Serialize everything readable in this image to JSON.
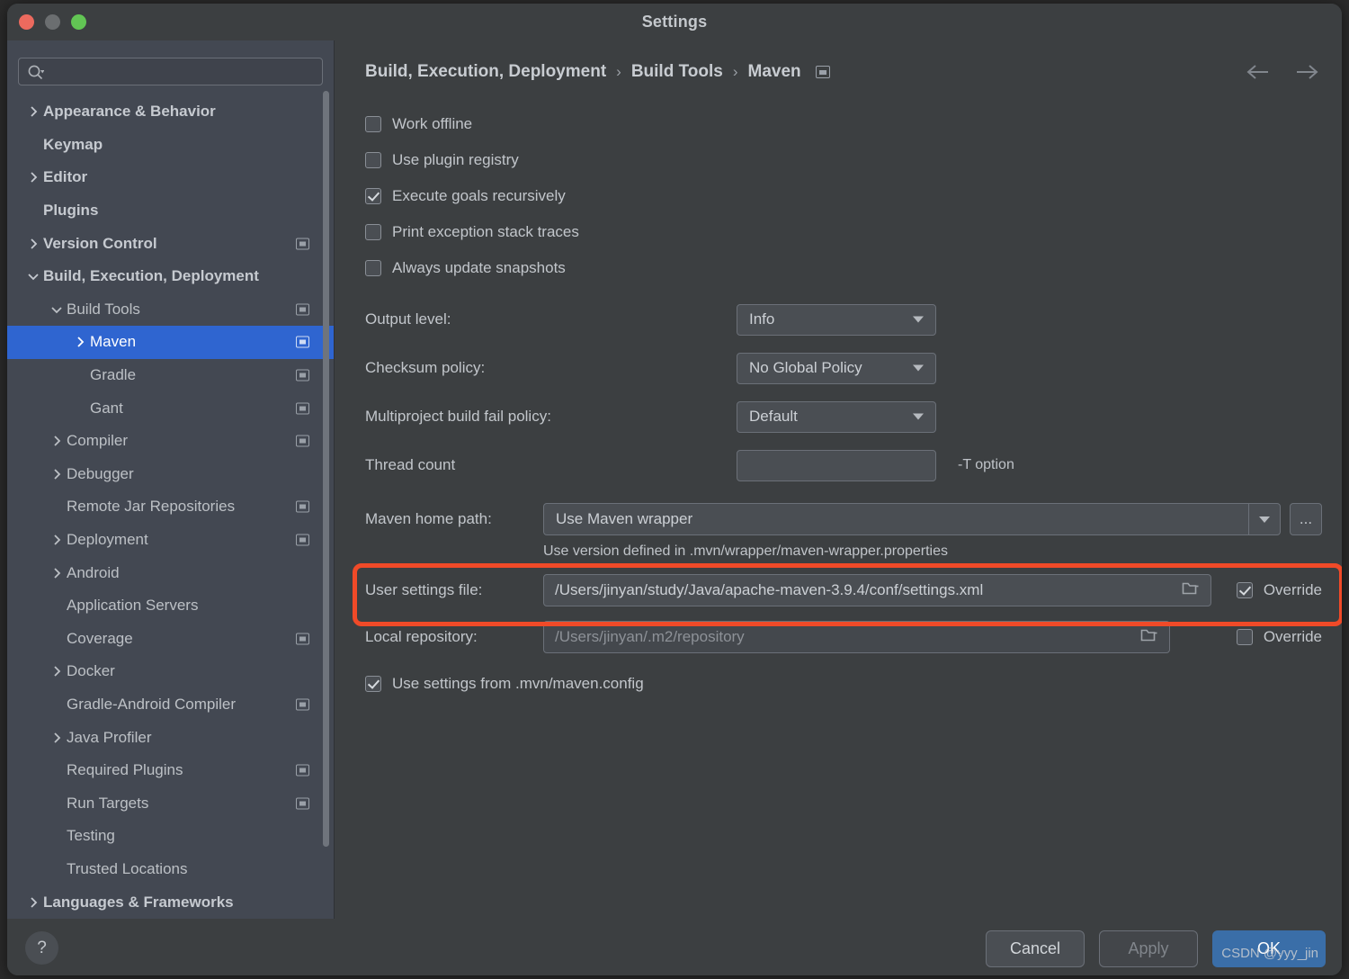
{
  "window": {
    "title": "Settings",
    "traffic_lights": [
      "close-red",
      "minimize-yellow",
      "zoom-green"
    ]
  },
  "search": {
    "value": "",
    "placeholder": "",
    "icon": "search-icon"
  },
  "sidebar": {
    "items": [
      {
        "label": "Appearance & Behavior",
        "indent": 0,
        "chevron": "right",
        "bold": true,
        "badge": false
      },
      {
        "label": "Keymap",
        "indent": 0,
        "chevron": "none",
        "bold": true,
        "badge": false
      },
      {
        "label": "Editor",
        "indent": 0,
        "chevron": "right",
        "bold": true,
        "badge": false
      },
      {
        "label": "Plugins",
        "indent": 0,
        "chevron": "none",
        "bold": true,
        "badge": false
      },
      {
        "label": "Version Control",
        "indent": 0,
        "chevron": "right",
        "bold": true,
        "badge": true
      },
      {
        "label": "Build, Execution, Deployment",
        "indent": 0,
        "chevron": "down",
        "bold": true,
        "badge": false
      },
      {
        "label": "Build Tools",
        "indent": 1,
        "chevron": "down",
        "bold": false,
        "badge": true
      },
      {
        "label": "Maven",
        "indent": 2,
        "chevron": "right",
        "bold": false,
        "badge": true,
        "selected": true
      },
      {
        "label": "Gradle",
        "indent": 2,
        "chevron": "none",
        "bold": false,
        "badge": true
      },
      {
        "label": "Gant",
        "indent": 2,
        "chevron": "none",
        "bold": false,
        "badge": true
      },
      {
        "label": "Compiler",
        "indent": 1,
        "chevron": "right",
        "bold": false,
        "badge": true
      },
      {
        "label": "Debugger",
        "indent": 1,
        "chevron": "right",
        "bold": false,
        "badge": false
      },
      {
        "label": "Remote Jar Repositories",
        "indent": 1,
        "chevron": "none",
        "bold": false,
        "badge": true
      },
      {
        "label": "Deployment",
        "indent": 1,
        "chevron": "right",
        "bold": false,
        "badge": true
      },
      {
        "label": "Android",
        "indent": 1,
        "chevron": "right",
        "bold": false,
        "badge": false
      },
      {
        "label": "Application Servers",
        "indent": 1,
        "chevron": "none",
        "bold": false,
        "badge": false
      },
      {
        "label": "Coverage",
        "indent": 1,
        "chevron": "none",
        "bold": false,
        "badge": true
      },
      {
        "label": "Docker",
        "indent": 1,
        "chevron": "right",
        "bold": false,
        "badge": false
      },
      {
        "label": "Gradle-Android Compiler",
        "indent": 1,
        "chevron": "none",
        "bold": false,
        "badge": true
      },
      {
        "label": "Java Profiler",
        "indent": 1,
        "chevron": "right",
        "bold": false,
        "badge": false
      },
      {
        "label": "Required Plugins",
        "indent": 1,
        "chevron": "none",
        "bold": false,
        "badge": true
      },
      {
        "label": "Run Targets",
        "indent": 1,
        "chevron": "none",
        "bold": false,
        "badge": true
      },
      {
        "label": "Testing",
        "indent": 1,
        "chevron": "none",
        "bold": false,
        "badge": false
      },
      {
        "label": "Trusted Locations",
        "indent": 1,
        "chevron": "none",
        "bold": false,
        "badge": false
      },
      {
        "label": "Languages & Frameworks",
        "indent": 0,
        "chevron": "right",
        "bold": true,
        "badge": false
      }
    ]
  },
  "breadcrumb": {
    "part1": "Build, Execution, Deployment",
    "sep1": "›",
    "part2": "Build Tools",
    "sep2": "›",
    "part3": "Maven",
    "badge_icon": "project-scope-badge-icon",
    "back_icon": "arrow-left-icon",
    "forward_icon": "arrow-right-icon"
  },
  "main": {
    "checkboxes": [
      {
        "label": "Work offline",
        "checked": false
      },
      {
        "label": "Use plugin registry",
        "checked": false
      },
      {
        "label": "Execute goals recursively",
        "checked": true
      },
      {
        "label": "Print exception stack traces",
        "checked": false
      },
      {
        "label": "Always update snapshots",
        "checked": false
      }
    ],
    "fields": [
      {
        "label": "Output level:",
        "value": "Info",
        "type": "combo"
      },
      {
        "label": "Checksum policy:",
        "value": "No Global Policy",
        "type": "combo"
      },
      {
        "label": "Multiproject build fail policy:",
        "value": "Default",
        "type": "combo"
      },
      {
        "label": "Thread count",
        "value": "",
        "type": "text",
        "note": "-T option"
      }
    ],
    "maven_home": {
      "label": "Maven home path:",
      "value": "Use Maven wrapper",
      "browse_label": "...",
      "hint": "Use version defined in .mvn/wrapper/maven-wrapper.properties"
    },
    "user_settings": {
      "label": "User settings file:",
      "value": "/Users/jinyan/study/Java/apache-maven-3.9.4/conf/settings.xml",
      "override_label": "Override",
      "override_checked": true,
      "folder_icon": "folder-icon",
      "highlight_color": "#f04a28"
    },
    "local_repository": {
      "label": "Local repository:",
      "value": "/Users/jinyan/.m2/repository",
      "override_label": "Override",
      "override_checked": false,
      "folder_icon": "folder-icon",
      "disabled": true
    },
    "maven_config": {
      "label": "Use settings from .mvn/maven.config",
      "checked": true
    }
  },
  "footer": {
    "help_label": "?",
    "cancel_label": "Cancel",
    "apply_label": "Apply",
    "ok_label": "OK",
    "apply_disabled": true,
    "watermark": "CSDN @yyy_jin"
  }
}
